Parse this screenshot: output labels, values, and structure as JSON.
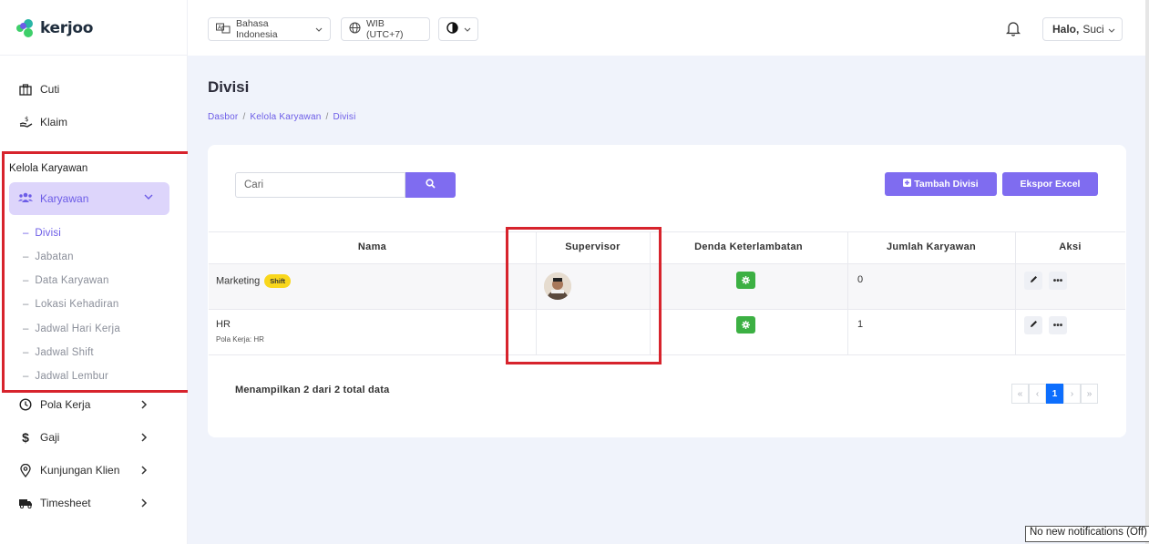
{
  "brand": {
    "name": "kerjoo"
  },
  "topbar": {
    "language": "Bahasa Indonesia",
    "timezone": "WIB (UTC+7)",
    "greeting_prefix": "Halo,",
    "user_name": "Suci"
  },
  "sidebar": {
    "items_top": [
      {
        "label": "Cuti",
        "icon": "briefcase-icon"
      },
      {
        "label": "Klaim",
        "icon": "hand-money-icon"
      }
    ],
    "section_label": "Kelola Karyawan",
    "group_label": "Karyawan",
    "sub_items": [
      {
        "label": "Divisi",
        "active": true
      },
      {
        "label": "Jabatan"
      },
      {
        "label": "Data Karyawan"
      },
      {
        "label": "Lokasi Kehadiran"
      },
      {
        "label": "Jadwal Hari Kerja"
      },
      {
        "label": "Jadwal Shift"
      },
      {
        "label": "Jadwal Lembur"
      }
    ],
    "items_bottom": [
      {
        "label": "Pola Kerja",
        "icon": "clock-icon"
      },
      {
        "label": "Gaji",
        "icon": "dollar-icon"
      },
      {
        "label": "Kunjungan Klien",
        "icon": "location-pin-icon"
      },
      {
        "label": "Timesheet",
        "icon": "truck-icon"
      }
    ]
  },
  "page": {
    "title": "Divisi",
    "breadcrumb": [
      "Dasbor",
      "Kelola Karyawan",
      "Divisi"
    ]
  },
  "toolbar": {
    "search_placeholder": "Cari",
    "add_label": "Tambah Divisi",
    "export_label": "Ekspor Excel"
  },
  "table": {
    "headers": [
      "Nama",
      "Supervisor",
      "Denda Keterlambatan",
      "Jumlah Karyawan",
      "Aksi"
    ],
    "rows": [
      {
        "name": "Marketing",
        "badge": "Shift",
        "sub": "",
        "has_supervisor": true,
        "count": "0"
      },
      {
        "name": "HR",
        "badge": "",
        "sub": "Pola Kerja: HR",
        "has_supervisor": false,
        "count": "1"
      }
    ]
  },
  "footer": {
    "summary": "Menampilkan 2 dari 2 total data",
    "pagination": {
      "first": "«",
      "prev": "‹",
      "current": "1",
      "next": "›",
      "last": "»"
    }
  },
  "tooltip": {
    "text": "No new notifications (Off)"
  },
  "colors": {
    "accent": "#7f6cf0",
    "highlight_box": "#d7232c",
    "success": "#3cb043",
    "badge": "#f9d71c"
  }
}
